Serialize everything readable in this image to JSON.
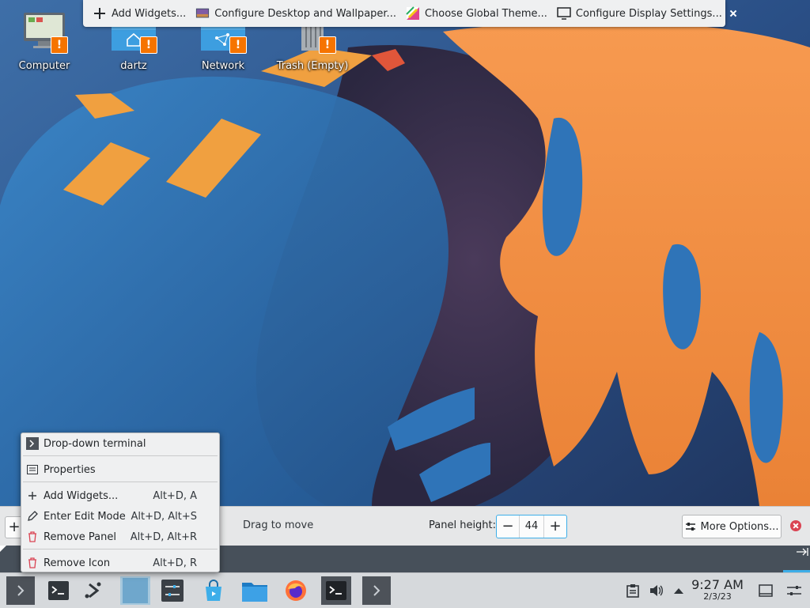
{
  "top_toolbar": {
    "add_widgets": "Add Widgets...",
    "configure_desktop": "Configure Desktop and Wallpaper...",
    "choose_global_theme": "Choose Global Theme...",
    "configure_display": "Configure Display Settings..."
  },
  "desktop_icons": [
    {
      "label": "Computer",
      "icon": "computer-icon"
    },
    {
      "label": "dartz",
      "icon": "home-folder-icon"
    },
    {
      "label": "Network",
      "icon": "network-folder-icon"
    },
    {
      "label": "Trash (Empty)",
      "icon": "trash-icon"
    }
  ],
  "panel_config": {
    "drag_to_move": "Drag to move",
    "panel_height_label": "Panel height:",
    "panel_height_value": "44",
    "more_options": "More Options..."
  },
  "context_menu": {
    "items": [
      {
        "label": "Drop-down terminal",
        "shortcut": ""
      },
      {
        "label": "Properties",
        "shortcut": ""
      },
      {
        "label": "Add Widgets...",
        "shortcut": "Alt+D, A"
      },
      {
        "label": "Enter Edit Mode",
        "shortcut": "Alt+D, Alt+S"
      },
      {
        "label": "Remove Panel",
        "shortcut": "Alt+D, Alt+R"
      },
      {
        "label": "Remove Icon",
        "shortcut": "Alt+D, R"
      }
    ]
  },
  "taskbar": {
    "time": "9:27 AM",
    "date": "2/3/23"
  },
  "colors": {
    "accent": "#3daee9",
    "close_red": "#da4453",
    "warning_orange": "#f67400",
    "wallpaper_orange": "#f08a3e",
    "wallpaper_blue": "#2a6cb0"
  }
}
